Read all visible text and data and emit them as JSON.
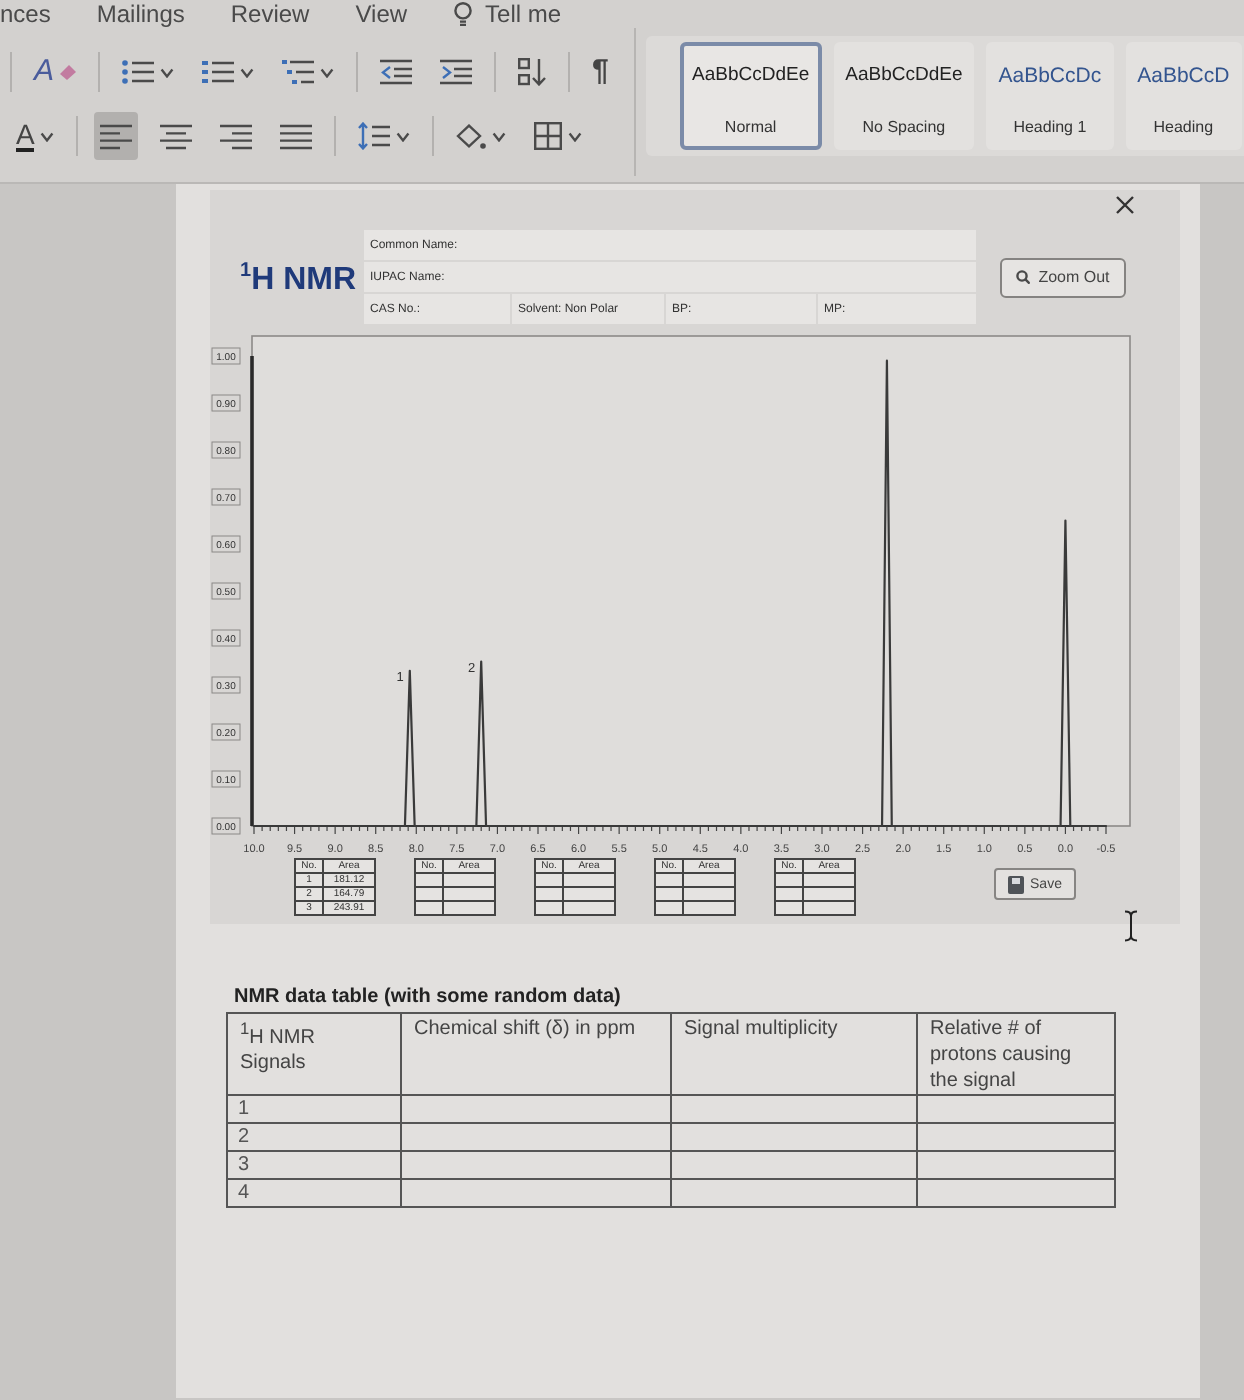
{
  "ribbon": {
    "tabs": [
      "nces",
      "Mailings",
      "Review",
      "View"
    ],
    "tell_me": "Tell me",
    "tool_rows": [
      [
        {
          "kind": "separator"
        },
        {
          "kind": "clear_formatting",
          "glyph": "A",
          "dropdown": false
        },
        {
          "kind": "separator"
        },
        {
          "kind": "bullets",
          "dropdown": true
        },
        {
          "kind": "numbering",
          "dropdown": true
        },
        {
          "kind": "multilevel",
          "dropdown": true
        },
        {
          "kind": "separator"
        },
        {
          "kind": "decrease_indent",
          "dropdown": false
        },
        {
          "kind": "increase_indent",
          "dropdown": false
        },
        {
          "kind": "separator"
        },
        {
          "kind": "sort",
          "dropdown": false
        },
        {
          "kind": "separator"
        },
        {
          "kind": "show_formatting",
          "glyph": "¶",
          "dropdown": false
        }
      ],
      [
        {
          "kind": "font_color",
          "glyph": "A",
          "dropdown": true
        },
        {
          "kind": "separator"
        },
        {
          "kind": "align_left",
          "selected": true,
          "dropdown": false
        },
        {
          "kind": "align_center",
          "selected": false,
          "dropdown": false
        },
        {
          "kind": "align_right",
          "selected": false,
          "dropdown": false
        },
        {
          "kind": "justify",
          "selected": false,
          "dropdown": false
        },
        {
          "kind": "separator"
        },
        {
          "kind": "line_spacing",
          "dropdown": true
        },
        {
          "kind": "separator"
        },
        {
          "kind": "shading",
          "dropdown": true
        },
        {
          "kind": "borders",
          "dropdown": true
        }
      ]
    ],
    "styles": [
      {
        "kind": "body",
        "sample": "AaBbCcDdEe",
        "name": "Normal",
        "selected": true
      },
      {
        "kind": "body",
        "sample": "AaBbCcDdEe",
        "name": "No Spacing",
        "selected": false
      },
      {
        "kind": "heading",
        "sample": "AaBbCcDc",
        "name": "Heading 1",
        "selected": false
      },
      {
        "kind": "heading",
        "sample": "AaBbCcD",
        "name": "Heading",
        "selected": false
      }
    ]
  },
  "nmr_panel": {
    "title": "$^{1}$H NMR",
    "info_rows": [
      [
        "Common Name:"
      ],
      [
        "IUPAC Name:"
      ],
      [
        "CAS No.:",
        "Solvent: Non Polar",
        "BP:",
        "MP:"
      ]
    ],
    "zoom_button": "Zoom Out",
    "spectrum": {
      "chart_data": {
        "type": "line",
        "x": [
          10.0,
          8.14,
          8.08,
          8.02,
          7.26,
          7.2,
          7.14,
          2.26,
          2.2,
          2.14,
          0.06,
          0.0,
          -0.06,
          -0.5
        ],
        "values": [
          0,
          0,
          0.33,
          0,
          0,
          0.35,
          0,
          0,
          0.99,
          0,
          0,
          0.65,
          0,
          0
        ],
        "xlim": [
          10.0,
          -0.5
        ],
        "ylim": [
          0,
          1
        ],
        "xticks": [
          {
            "value": 10.0,
            "label": "10.0"
          },
          {
            "value": 9.5,
            "label": "9.5"
          },
          {
            "value": 9.0,
            "label": "9.0"
          },
          {
            "value": 8.5,
            "label": "8.5"
          },
          {
            "value": 8.0,
            "label": "8.0"
          },
          {
            "value": 7.5,
            "label": "7.5"
          },
          {
            "value": 7.0,
            "label": "7.0"
          },
          {
            "value": 6.5,
            "label": "6.5"
          },
          {
            "value": 6.0,
            "label": "6.0"
          },
          {
            "value": 5.5,
            "label": "5.5"
          },
          {
            "value": 5.0,
            "label": "5.0"
          },
          {
            "value": 4.5,
            "label": "4.5"
          },
          {
            "value": 4.0,
            "label": "4.0"
          },
          {
            "value": 3.5,
            "label": "3.5"
          },
          {
            "value": 3.0,
            "label": "3.0"
          },
          {
            "value": 2.5,
            "label": "2.5"
          },
          {
            "value": 2.0,
            "label": "2.0"
          },
          {
            "value": 1.5,
            "label": "1.5"
          },
          {
            "value": 1.0,
            "label": "1.0"
          },
          {
            "value": 0.5,
            "label": "0.5"
          },
          {
            "value": 0.0,
            "label": "0.0"
          },
          {
            "value": -0.5,
            "label": "-0.5"
          }
        ],
        "yticks": [
          {
            "value": 0,
            "label": "0.00"
          },
          {
            "value": 0.1,
            "label": "0.10"
          },
          {
            "value": 0.2,
            "label": "0.20"
          },
          {
            "value": 0.3,
            "label": "0.30"
          },
          {
            "value": 0.4,
            "label": "0.40"
          },
          {
            "value": 0.5,
            "label": "0.50"
          },
          {
            "value": 0.6,
            "label": "0.60"
          },
          {
            "value": 0.7,
            "label": "0.70"
          },
          {
            "value": 0.8,
            "label": "0.80"
          },
          {
            "value": 0.9,
            "label": "0.90"
          },
          {
            "value": 1,
            "label": "1.00"
          }
        ],
        "annotations": [
          {
            "x": 8.08,
            "y": 0.33,
            "text": "1"
          },
          {
            "x": 7.2,
            "y": 0.35,
            "text": "2"
          }
        ]
      }
    },
    "integration_tables": [
      {
        "columns": [
          "No.",
          "Area"
        ],
        "rows": [
          {
            "no": "1",
            "area": "181.12"
          },
          {
            "no": "2",
            "area": "164.79"
          },
          {
            "no": "3",
            "area": "243.91"
          }
        ]
      },
      {
        "columns": [
          "No.",
          "Area"
        ],
        "rows": [
          {},
          {},
          {}
        ]
      },
      {
        "columns": [
          "No.",
          "Area"
        ],
        "rows": [
          {},
          {},
          {}
        ]
      },
      {
        "columns": [
          "No.",
          "Area"
        ],
        "rows": [
          {},
          {},
          {}
        ]
      },
      {
        "columns": [
          "No.",
          "Area"
        ],
        "rows": [
          {},
          {},
          {}
        ]
      }
    ],
    "save_button": "Save"
  },
  "data_table": {
    "title": "NMR data table (with some random data)",
    "columns": [
      "$^{1}$H NMR Signals",
      "Chemical shift (δ) in ppm",
      "Signal multiplicity",
      "Relative # of protons causing the signal"
    ],
    "rows": [
      {
        "signal": "1"
      },
      {
        "signal": "2"
      },
      {
        "signal": "3"
      },
      {
        "signal": "4"
      }
    ]
  }
}
